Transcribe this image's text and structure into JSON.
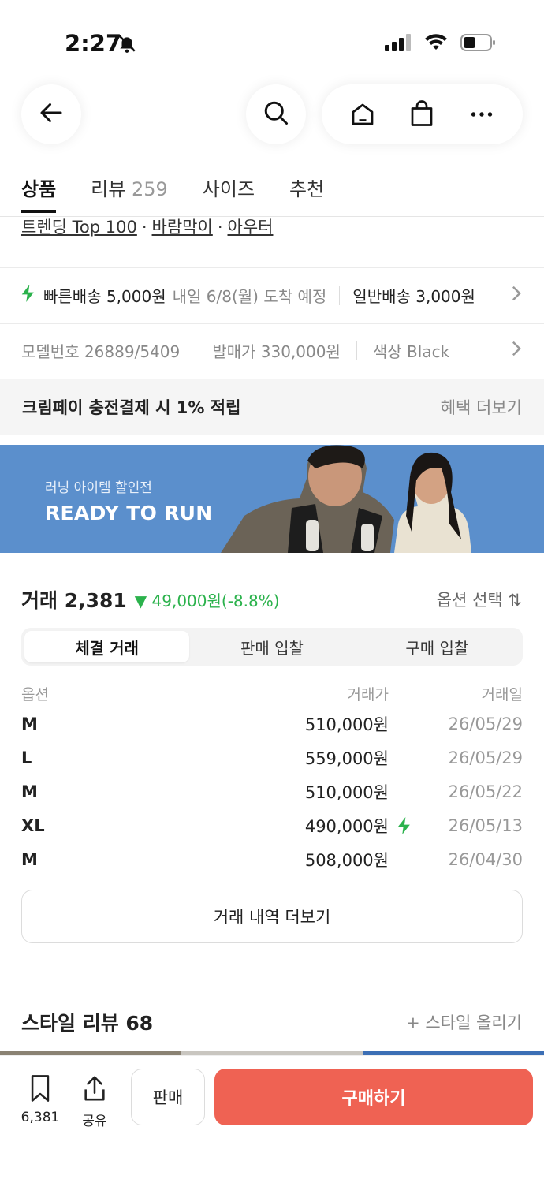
{
  "status": {
    "time": "2:27"
  },
  "header": {
    "icons": [
      "back-arrow-icon",
      "search-icon",
      "home-icon",
      "shopping-bag-icon",
      "more-icon"
    ]
  },
  "tabs": [
    {
      "label": "상품",
      "active": true
    },
    {
      "label": "리뷰",
      "count": "259"
    },
    {
      "label": "사이즈"
    },
    {
      "label": "추천"
    }
  ],
  "breadcrumb": {
    "items": [
      "트렌딩 Top 100",
      "바람막이",
      "아우터"
    ],
    "separator": "·"
  },
  "delivery": {
    "fast_label": "빠른배송 5,000원",
    "fast_eta": "내일 6/8(월) 도착 예정",
    "normal_label": "일반배송 3,000원"
  },
  "specs": {
    "model": "모델번호 26889/5409",
    "release_price": "발매가 330,000원",
    "color": "색상 Black"
  },
  "promo": {
    "text": "크림페이 충전결제 시 1% 적립",
    "link": "혜택 더보기"
  },
  "banner": {
    "subtitle": "러닝 아이템 할인전",
    "title": "READY TO RUN"
  },
  "trade": {
    "title": "거래 2,381",
    "change": "▼ 49,000원(-8.8%)",
    "option_select": "옵션 선택 ⇅",
    "segments": [
      "체결 거래",
      "판매 입찰",
      "구매 입찰"
    ],
    "active_segment": 0,
    "columns": [
      "옵션",
      "거래가",
      "거래일"
    ],
    "rows": [
      {
        "option": "M",
        "price": "510,000원",
        "date": "26/05/29",
        "fast": false
      },
      {
        "option": "L",
        "price": "559,000원",
        "date": "26/05/29",
        "fast": false
      },
      {
        "option": "M",
        "price": "510,000원",
        "date": "26/05/22",
        "fast": false
      },
      {
        "option": "XL",
        "price": "490,000원",
        "date": "26/05/13",
        "fast": true
      },
      {
        "option": "M",
        "price": "508,000원",
        "date": "26/04/30",
        "fast": false
      }
    ],
    "more_label": "거래 내역 더보기"
  },
  "style_review": {
    "title": "스타일 리뷰 68",
    "upload": "+ 스타일 올리기"
  },
  "bottom": {
    "save_count": "6,381",
    "share_label": "공유",
    "sell_label": "판매",
    "buy_label": "구매하기"
  },
  "colors": {
    "accent_buy": "#ef6253",
    "price_down": "#2bb24c",
    "banner_bg": "#5b8fcc"
  }
}
